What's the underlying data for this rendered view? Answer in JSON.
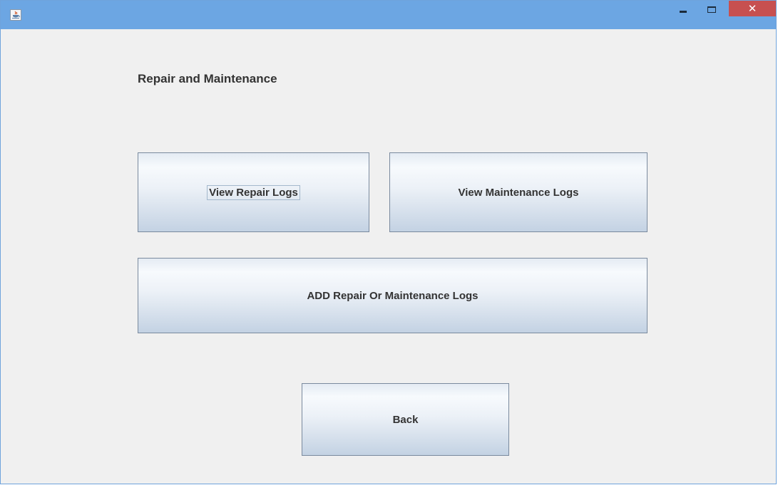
{
  "window": {
    "app_icon": "java-cup-icon",
    "controls": {
      "minimize_icon": "minimize-icon",
      "maximize_icon": "maximize-icon",
      "close_icon": "close-icon",
      "close_glyph": "✕"
    },
    "colors": {
      "titlebar": "#6ca6e3",
      "close_button": "#c75050",
      "background": "#efefef"
    }
  },
  "main": {
    "heading": "Repair and Maintenance",
    "buttons": {
      "view_repair_logs": "View Repair Logs",
      "view_maintenance_logs": "View Maintenance Logs",
      "add_logs": "ADD Repair Or Maintenance Logs",
      "back": "Back"
    },
    "focused_button": "View Repair Logs"
  }
}
